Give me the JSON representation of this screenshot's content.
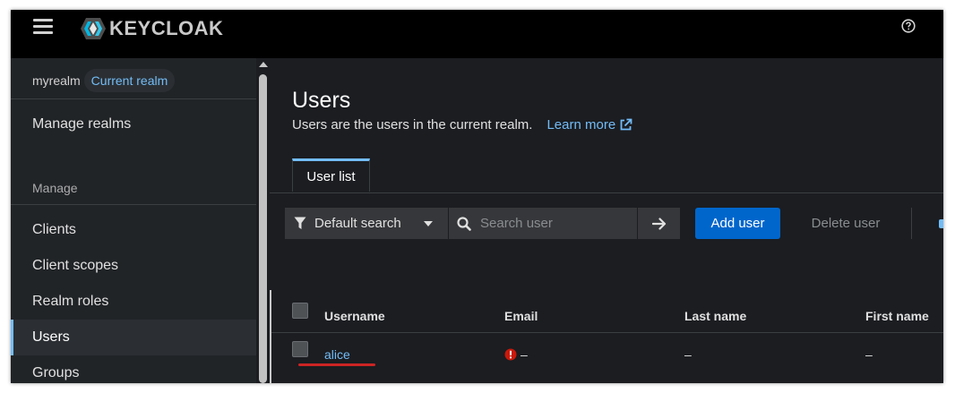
{
  "brand": {
    "name": "KEYCLOAK"
  },
  "realm": {
    "name": "myrealm",
    "badge": "Current realm"
  },
  "sidebar": {
    "manage_realms": "Manage realms",
    "section_title": "Manage",
    "items": [
      {
        "label": "Clients"
      },
      {
        "label": "Client scopes"
      },
      {
        "label": "Realm roles"
      },
      {
        "label": "Users"
      },
      {
        "label": "Groups"
      }
    ],
    "active_item": "Users"
  },
  "page": {
    "title": "Users",
    "description": "Users are the users in the current realm.",
    "learn_more": "Learn more"
  },
  "tabs": [
    {
      "label": "User list"
    }
  ],
  "toolbar": {
    "filter_label": "Default search",
    "search_placeholder": "Search user",
    "add_user": "Add user",
    "delete_user": "Delete user"
  },
  "table": {
    "columns": [
      "Username",
      "Email",
      "Last name",
      "First name"
    ],
    "rows": [
      {
        "username": "alice",
        "email": "–",
        "last_name": "–",
        "first_name": "–"
      }
    ]
  },
  "colors": {
    "accent": "#73bcf7",
    "primary_button": "#0066cc",
    "error_icon": "#c9190b",
    "annotation_underline": "#cc2424"
  }
}
